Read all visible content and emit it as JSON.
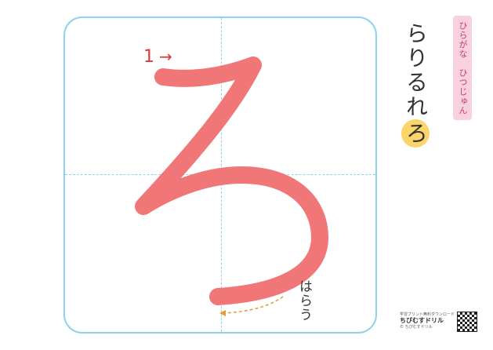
{
  "practice": {
    "character": "ろ",
    "stroke_number": "1",
    "stroke_arrow": "→",
    "ending_label": "はらう"
  },
  "sidebar": {
    "row_label": "ひらがな　ひつじゅん",
    "kana": [
      "ら",
      "り",
      "る",
      "れ"
    ],
    "current_kana": "ろ"
  },
  "footer": {
    "line1": "学習プリント無料ダウンロード",
    "brand": "ちびむすドリル",
    "line2": "© ちびむすドリル"
  },
  "colors": {
    "stroke": "#f07678",
    "guide": "#8fd3ea",
    "accent_red": "#d63a3a",
    "label_bg": "#f8d0df",
    "highlight": "#fbd46a"
  }
}
